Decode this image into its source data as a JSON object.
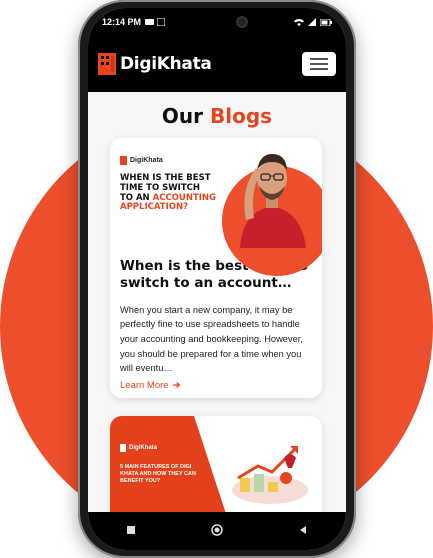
{
  "status_bar": {
    "time": "12:14 PM"
  },
  "navbar": {
    "brand": "DigiKhata"
  },
  "blogs": {
    "title_prefix": "Our",
    "title_accent": "Blogs"
  },
  "posts": [
    {
      "thumb_brand": "DigiKhata",
      "thumb_headline_1": "WHEN IS THE BEST",
      "thumb_headline_2": "TIME TO SWITCH",
      "thumb_headline_3": "TO AN",
      "thumb_headline_accent": "ACCOUNTING APPLICATION?",
      "title": "When is the best time to switch to an account…",
      "excerpt": "When you start a new company, it may be perfectly fine to use spreadsheets to handle your accounting and bookkeeping. However,  you should be prepared for a time when you will eventu…",
      "read_more": "Learn More"
    },
    {
      "thumb_brand": "DigiKhata",
      "thumb_headline": "5 MAIN FEATURES OF DIGI KHATA AND HOW THEY CAN BENEFIT YOU?"
    }
  ],
  "colors": {
    "accent": "#e64520",
    "background_circle": "#ed4e2c"
  }
}
